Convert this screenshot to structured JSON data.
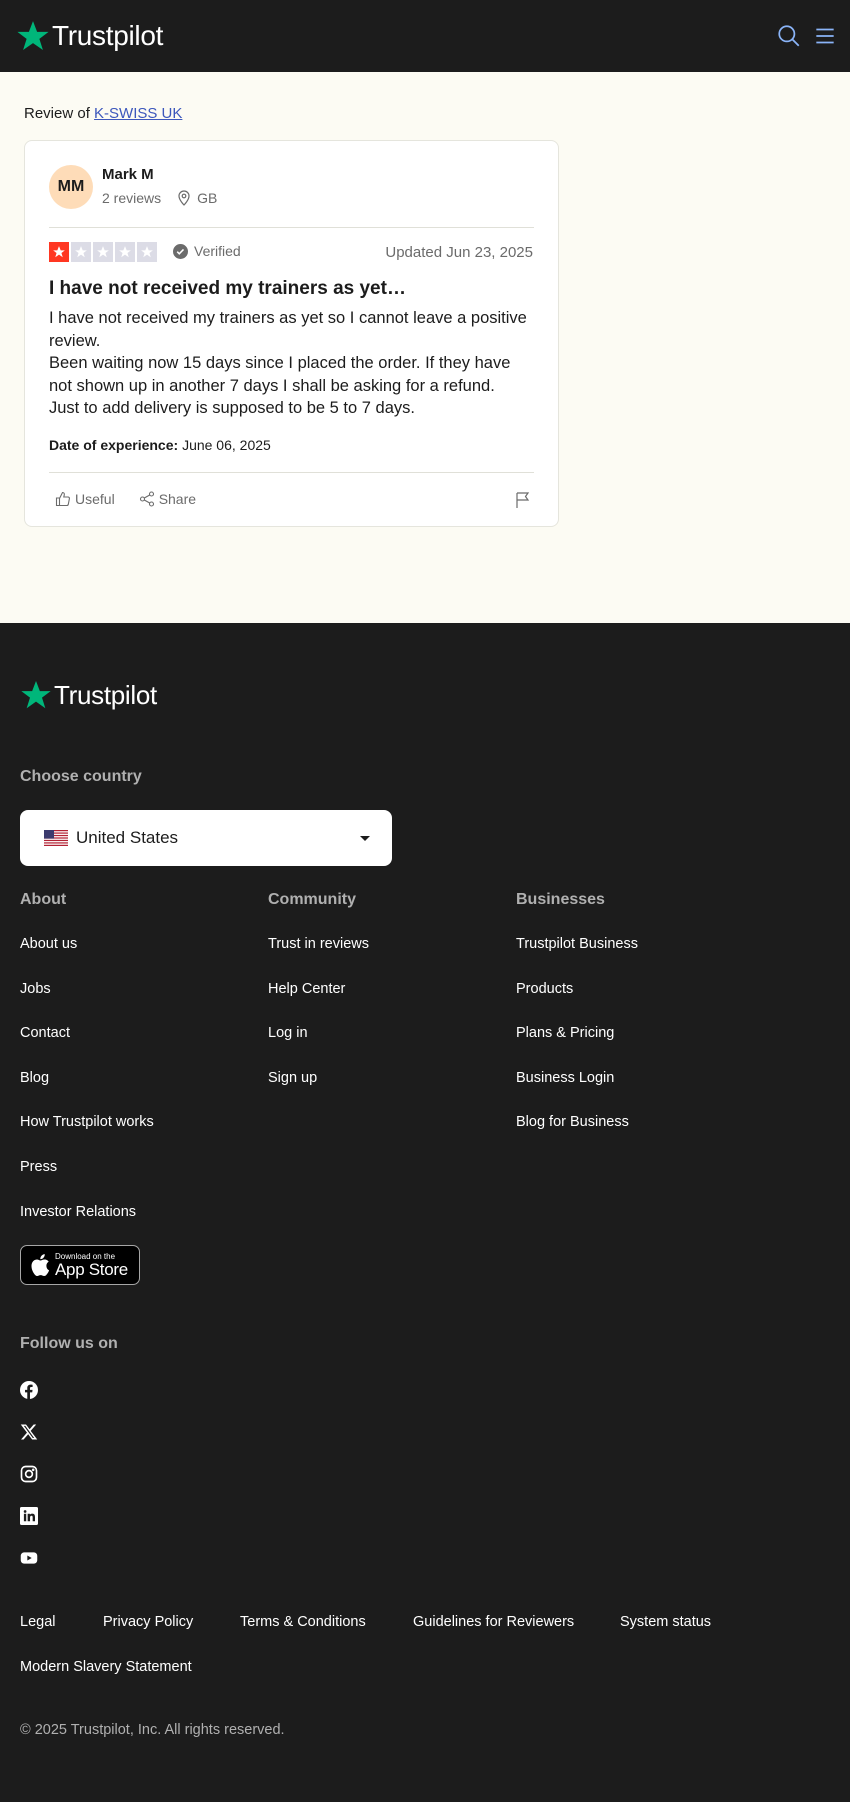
{
  "header": {
    "brand": "Trustpilot",
    "search_icon": "search-icon",
    "menu_icon": "menu-icon"
  },
  "review_of": {
    "prefix": "Review of",
    "company": "K-SWISS UK"
  },
  "review": {
    "avatar_initials": "MM",
    "reviewer_name": "Mark M",
    "reviews_count": "2 reviews",
    "country": "GB",
    "rating": 1,
    "rating_max": 5,
    "verified_label": "Verified",
    "updated": "Updated Jun 23, 2025",
    "title": "I have not received my trainers as yet…",
    "body_lines": [
      "I have not received my trainers as yet so I cannot leave a positive review.",
      "Been waiting now 15 days since I placed the order. If they have not shown up in another 7 days I shall be asking for a refund.",
      "Just to add delivery is supposed to be 5 to 7 days."
    ],
    "date_label": "Date of experience:",
    "date_value": "June 06, 2025",
    "useful_label": "Useful",
    "share_label": "Share"
  },
  "colors": {
    "star_red": "#ff3722",
    "star_empty": "#dcdce6",
    "link_blue": "#3c57bc",
    "trustpilot_green": "#00b67a",
    "footer_bg": "#1c1c1c",
    "main_bg": "#fcfbf3"
  },
  "footer": {
    "brand": "Trustpilot",
    "choose_country": "Choose country",
    "country_selected": "United States",
    "about": {
      "heading": "About",
      "links": [
        "About us",
        "Jobs",
        "Contact",
        "Blog",
        "How Trustpilot works",
        "Press",
        "Investor Relations"
      ]
    },
    "community": {
      "heading": "Community",
      "links": [
        "Trust in reviews",
        "Help Center",
        "Log in",
        "Sign up"
      ]
    },
    "businesses": {
      "heading": "Businesses",
      "links": [
        "Trustpilot Business",
        "Products",
        "Plans & Pricing",
        "Business Login",
        "Blog for Business"
      ]
    },
    "appstore_small": "Download on the",
    "appstore_big": "App Store",
    "follow_us": "Follow us on",
    "social_icons": [
      "facebook-icon",
      "x-icon",
      "instagram-icon",
      "linkedin-icon",
      "youtube-icon"
    ],
    "legal_links": [
      "Legal",
      "Privacy Policy",
      "Terms & Conditions",
      "Guidelines for Reviewers",
      "System status",
      "Modern Slavery Statement"
    ],
    "copyright": "© 2025 Trustpilot, Inc. All rights reserved."
  }
}
